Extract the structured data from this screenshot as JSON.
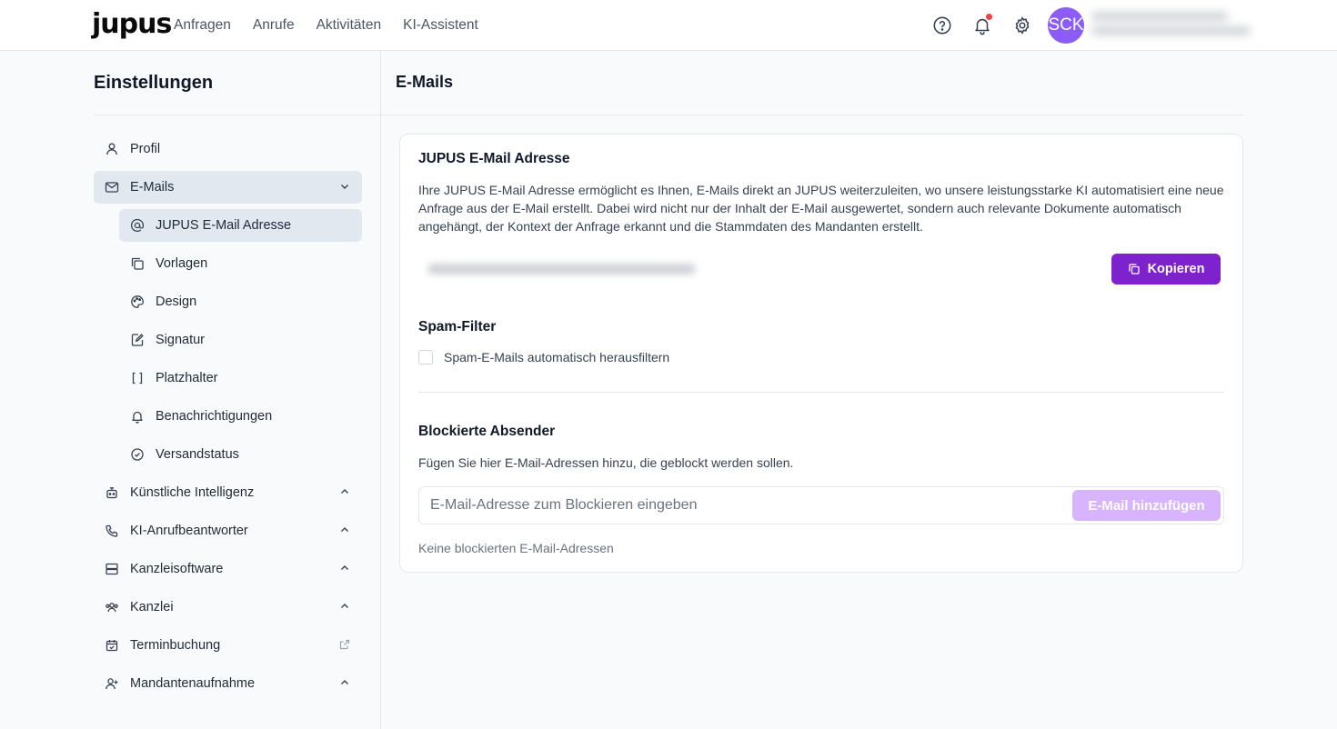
{
  "brand": "jupus",
  "nav": [
    "Anfragen",
    "Anrufe",
    "Aktivitäten",
    "KI-Assistent"
  ],
  "top_icons": [
    "help-icon",
    "bell-icon",
    "settings-icon"
  ],
  "user": {
    "initials": "SCK"
  },
  "sidebar": {
    "title": "Einstellungen",
    "items": {
      "profil": "Profil",
      "emails": "E-Mails",
      "jupus_email": "JUPUS E-Mail Adresse",
      "vorlagen": "Vorlagen",
      "design": "Design",
      "signatur": "Signatur",
      "platzhalter": "Platzhalter",
      "benachrichtigungen": "Benachrichtigungen",
      "versandstatus": "Versandstatus",
      "ki": "Künstliche Intelligenz",
      "ki_anruf": "KI-Anrufbeantworter",
      "kanzleisoftware": "Kanzleisoftware",
      "kanzlei": "Kanzlei",
      "terminbuchung": "Terminbuchung",
      "mandantenaufnahme": "Mandantenaufnahme"
    }
  },
  "main": {
    "title": "E-Mails",
    "jupus_section": {
      "heading": "JUPUS E-Mail Adresse",
      "description": "Ihre JUPUS E-Mail Adresse ermöglicht es Ihnen, E-Mails direkt an JUPUS weiterzuleiten, wo unsere leistungsstarke KI automatisiert eine neue Anfrage aus der E-Mail erstellt. Dabei wird nicht nur der Inhalt der E-Mail ausgewertet, sondern auch relevante Dokumente automatisch angehängt, der Kontext der Anfrage erkannt und die Stammdaten des Mandanten erstellt.",
      "copy_button": "Kopieren"
    },
    "spam_section": {
      "heading": "Spam-Filter",
      "checkbox_label": "Spam-E-Mails automatisch herausfiltern",
      "checked": false
    },
    "blocked_section": {
      "heading": "Blockierte Absender",
      "description": "Fügen Sie hier E-Mail-Adressen hinzu, die geblockt werden sollen.",
      "input_placeholder": "E-Mail-Adresse zum Blockieren eingeben",
      "add_button": "E-Mail hinzufügen",
      "empty_text": "Keine blockierten E-Mail-Adressen"
    }
  },
  "colors": {
    "primary": "#7e22ce",
    "primary_disabled": "#d8b4fe",
    "avatar": "#8b5cf6",
    "active_bg": "#e2e8f0",
    "notification": "#ef4444"
  }
}
